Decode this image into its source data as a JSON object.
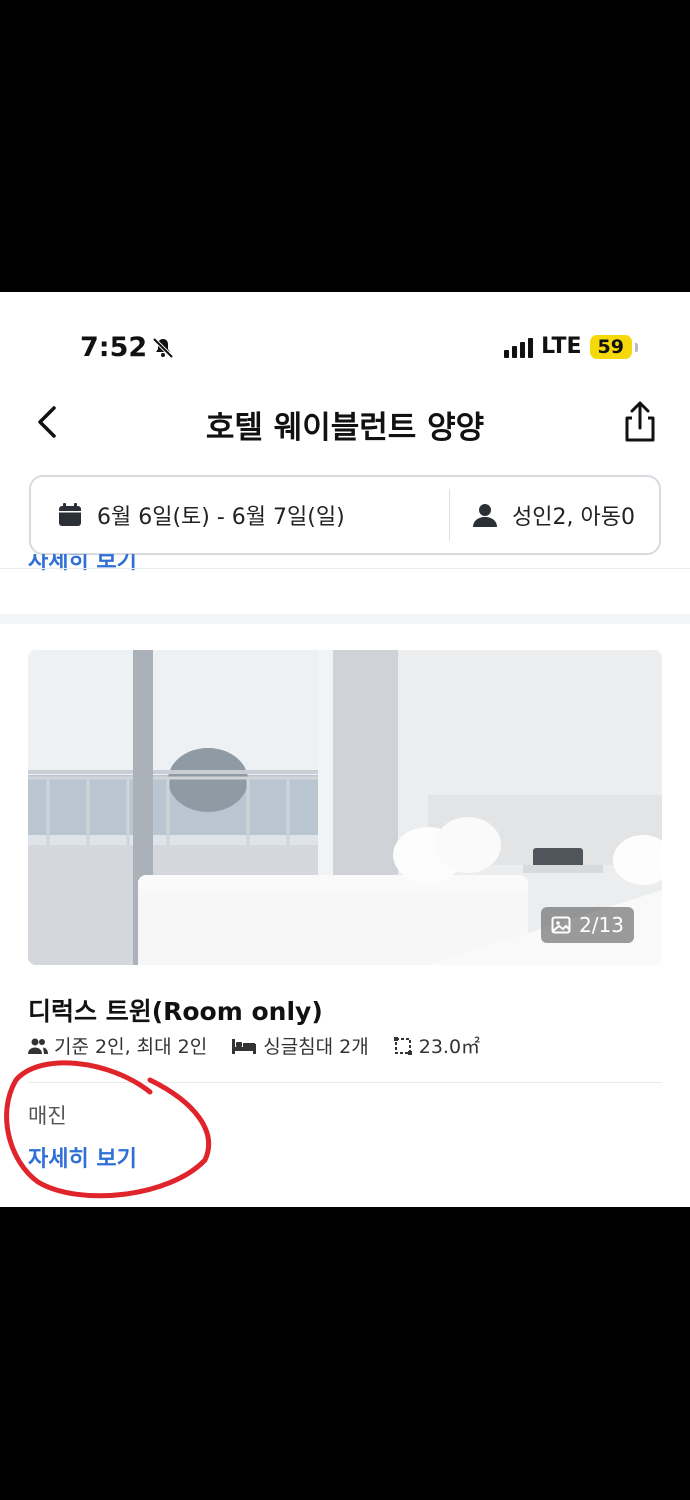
{
  "status_bar": {
    "time": "7:52",
    "network": "LTE",
    "battery": "59"
  },
  "nav": {
    "title": "호텔 웨이블런트 양양"
  },
  "search": {
    "dates": "6월 6일(토) - 6월 7일(일)",
    "guests": "성인2, 아동0"
  },
  "previous_section": {
    "link_label": "자세히 보기"
  },
  "room": {
    "photo_counter": "2/13",
    "name": "디럭스 트윈(Room only)",
    "capacity": "기준 2인, 최대 2인",
    "bed": "싱글침대 2개",
    "size": "23.0㎡",
    "status": "매진",
    "detail_link": "자세히 보기"
  },
  "colors": {
    "link": "#2f6fd6",
    "battery": "#f5d90a",
    "annotation": "#e0242b"
  }
}
